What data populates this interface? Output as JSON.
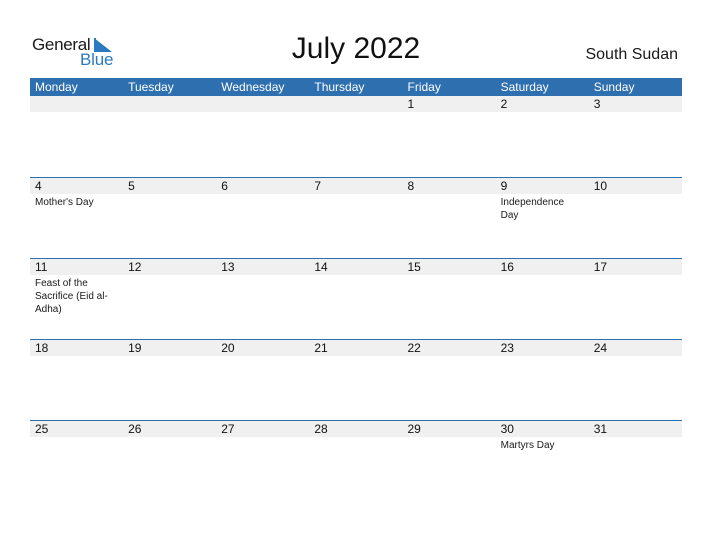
{
  "logo": {
    "general": "General",
    "blue": "Blue"
  },
  "title": "July 2022",
  "country": "South Sudan",
  "colors": {
    "accent": "#2e6fb0",
    "date_strip": "#f0f0f0",
    "logo_blue": "#2a7ac0"
  },
  "weekdays": [
    "Monday",
    "Tuesday",
    "Wednesday",
    "Thursday",
    "Friday",
    "Saturday",
    "Sunday"
  ],
  "weeks": [
    {
      "days": [
        "",
        "",
        "",
        "",
        "1",
        "2",
        "3"
      ],
      "events": [
        "",
        "",
        "",
        "",
        "",
        "",
        ""
      ]
    },
    {
      "days": [
        "4",
        "5",
        "6",
        "7",
        "8",
        "9",
        "10"
      ],
      "events": [
        "Mother's Day",
        "",
        "",
        "",
        "",
        "Independence Day",
        ""
      ]
    },
    {
      "days": [
        "11",
        "12",
        "13",
        "14",
        "15",
        "16",
        "17"
      ],
      "events": [
        "Feast of the Sacrifice (Eid al-Adha)",
        "",
        "",
        "",
        "",
        "",
        ""
      ]
    },
    {
      "days": [
        "18",
        "19",
        "20",
        "21",
        "22",
        "23",
        "24"
      ],
      "events": [
        "",
        "",
        "",
        "",
        "",
        "",
        ""
      ]
    },
    {
      "days": [
        "25",
        "26",
        "27",
        "28",
        "29",
        "30",
        "31"
      ],
      "events": [
        "",
        "",
        "",
        "",
        "",
        "Martyrs Day",
        ""
      ]
    }
  ]
}
